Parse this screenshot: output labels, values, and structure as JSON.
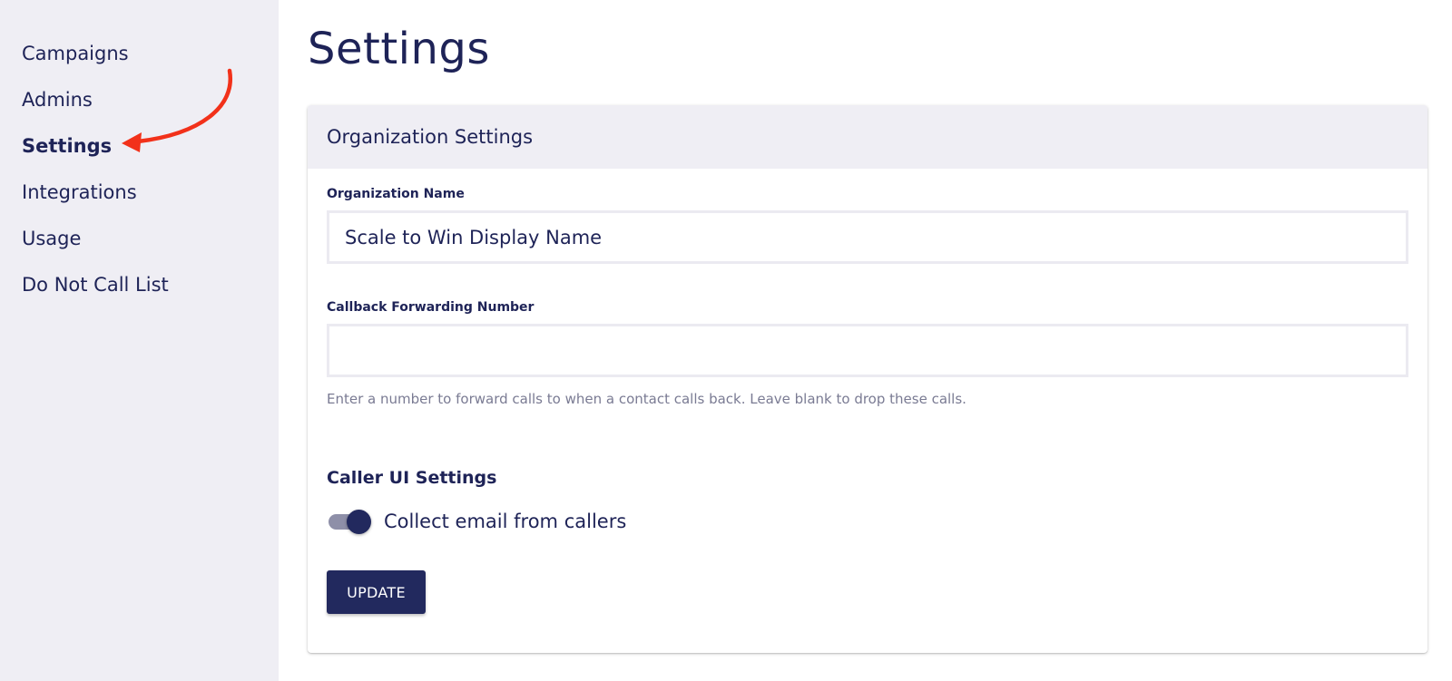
{
  "sidebar": {
    "items": [
      {
        "label": "Campaigns"
      },
      {
        "label": "Admins"
      },
      {
        "label": "Settings",
        "active": true
      },
      {
        "label": "Integrations"
      },
      {
        "label": "Usage"
      },
      {
        "label": "Do Not Call List"
      }
    ]
  },
  "annotation": {
    "arrow_color": "#f2311a"
  },
  "main": {
    "title": "Settings",
    "card": {
      "header": "Organization Settings",
      "org_name": {
        "label": "Organization Name",
        "value": "Scale to Win Display Name"
      },
      "callback": {
        "label": "Callback Forwarding Number",
        "value": "",
        "helper": "Enter a number to forward calls to when a contact calls back. Leave blank to drop these calls."
      },
      "caller_ui": {
        "heading": "Caller UI Settings",
        "toggle_label": "Collect email from callers",
        "toggle_on": true
      },
      "update_label": "UPDATE"
    }
  },
  "colors": {
    "primary": "#22295e",
    "text": "#1e2357",
    "sidebar_bg": "#efeef4",
    "helper_text": "#7a7b93"
  }
}
